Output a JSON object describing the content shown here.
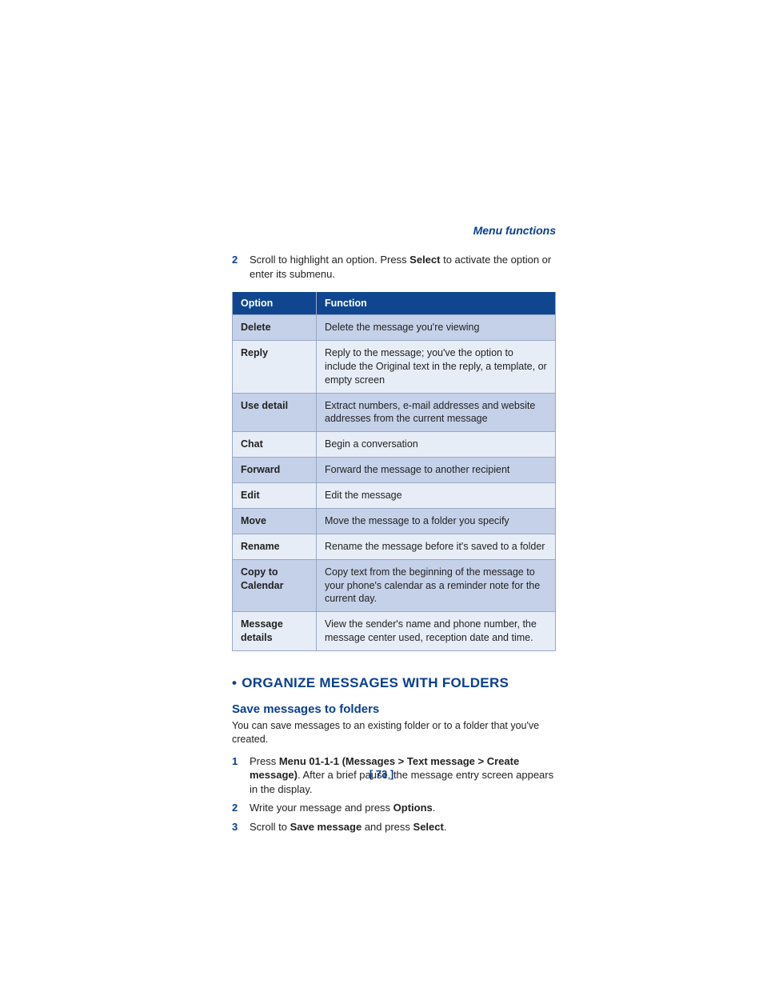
{
  "header": "Menu functions",
  "step2": {
    "num": "2",
    "pre": "Scroll to highlight an option. Press ",
    "bold": "Select",
    "post": " to activate the option or enter its submenu."
  },
  "table": {
    "headers": {
      "option": "Option",
      "function": "Function"
    },
    "rows": [
      {
        "option": "Delete",
        "function": "Delete the message you're viewing"
      },
      {
        "option": "Reply",
        "function": "Reply to the message; you've the option to include the Original text in the reply, a template, or empty screen"
      },
      {
        "option": "Use detail",
        "function": "Extract numbers, e-mail addresses and website addresses from the current message"
      },
      {
        "option": "Chat",
        "function": "Begin a conversation"
      },
      {
        "option": "Forward",
        "function": "Forward the message to another recipient"
      },
      {
        "option": "Edit",
        "function": "Edit the message"
      },
      {
        "option": "Move",
        "function": "Move the message to a folder you specify"
      },
      {
        "option": "Rename",
        "function": "Rename the message before it's saved to a folder"
      },
      {
        "option": "Copy to Calendar",
        "function": "Copy text from the beginning of the message to your phone's calendar as a reminder note for the current day."
      },
      {
        "option": "Message details",
        "function": "View the sender's name and phone number, the message center used, reception date and time."
      }
    ]
  },
  "section": {
    "bullet": "•",
    "h2": "ORGANIZE MESSAGES WITH FOLDERS",
    "h3": "Save messages to folders",
    "intro": "You can save messages to an existing folder or to a folder that you've created.",
    "steps": [
      {
        "num": "1",
        "pre": "Press ",
        "bold": "Menu 01-1-1 (Messages > Text message > Create message)",
        "post": ". After a brief pause, the message entry screen appears in the display."
      },
      {
        "num": "2",
        "pre": "Write your message and press ",
        "bold": "Options",
        "post": "."
      },
      {
        "num": "3",
        "pre": "Scroll to ",
        "bold": "Save message",
        "mid": " and press ",
        "bold2": "Select",
        "post": "."
      }
    ]
  },
  "pagenum": "[ 73 ]"
}
